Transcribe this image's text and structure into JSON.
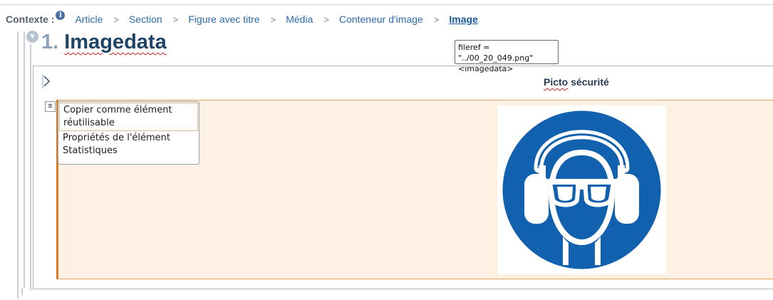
{
  "breadcrumb": {
    "label": "Contexte :",
    "info_icon": "info-icon",
    "items": [
      "Article",
      "Section",
      "Figure avec titre",
      "Média",
      "Conteneur d'image",
      "Image"
    ],
    "separator": ">"
  },
  "heading": {
    "number": "1.",
    "text": "Imagedata"
  },
  "tooltip": {
    "line1": "fileref = \"../00_20_049.png\"",
    "line2": "<imagedata>"
  },
  "figure": {
    "title_first": "Picto",
    "title_rest": " sécurité",
    "expand_icon": "chevron-right-icon"
  },
  "context_menu": {
    "items": [
      "Copier comme élément réutilisable",
      "Propriétés de l'élément",
      "Statistiques"
    ]
  },
  "colors": {
    "safety_blue": "#1261ae",
    "media_bg": "#fcf1e2",
    "media_accent": "#e07a1d",
    "link": "#2b6aa8"
  }
}
